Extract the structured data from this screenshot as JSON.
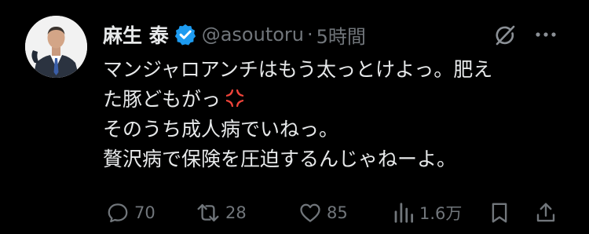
{
  "tweet": {
    "author_name": "麻生 泰",
    "handle": "@asoutoru",
    "separator": "·",
    "time": "5時間",
    "text_lines": [
      "マンジャロアンチはもう太っとけよっ。肥え",
      "た豚どもがっ",
      "そのうち成人病でいねっ。",
      "贅沢病で保険を圧迫するんじゃねーよ。"
    ],
    "emoji": "anger-symbol"
  },
  "actions": {
    "reply_count": "70",
    "repost_count": "28",
    "like_count": "85",
    "view_count": "1.6万"
  },
  "colors": {
    "background": "#000000",
    "text": "#e7e9ea",
    "muted": "#71767b",
    "verified": "#1d9bf0",
    "anger": "#f0443a"
  }
}
